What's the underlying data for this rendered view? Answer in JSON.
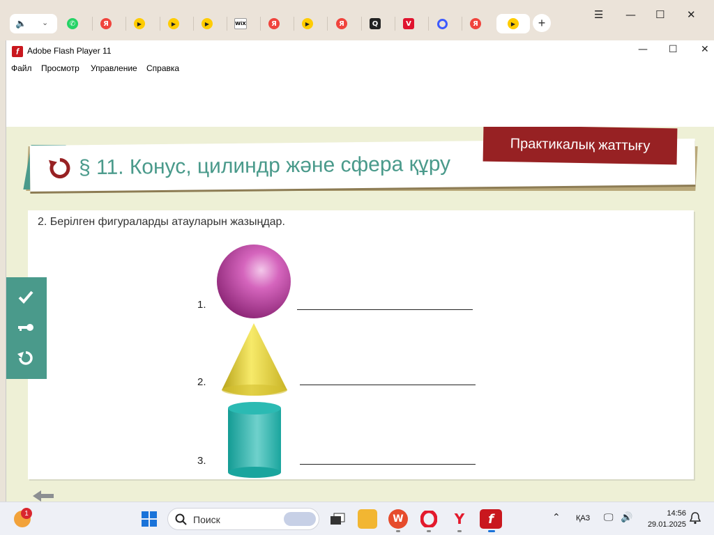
{
  "browser": {
    "window_controls": {
      "menu": "☰",
      "minimize": "—",
      "maximize": "☐",
      "close": "✕"
    },
    "tabs": [
      {
        "icon": "speaker-icon",
        "letter": "🔈"
      },
      {
        "icon": "whatsapp-icon",
        "letter": "✆"
      },
      {
        "icon": "yandex-icon",
        "letter": "Я"
      },
      {
        "icon": "play-icon",
        "letter": "▶"
      },
      {
        "icon": "play-icon",
        "letter": "▶"
      },
      {
        "icon": "play-icon",
        "letter": "▶"
      },
      {
        "icon": "wix-icon",
        "letter": "WiX"
      },
      {
        "icon": "yandex-icon",
        "letter": "Я"
      },
      {
        "icon": "play-icon",
        "letter": "▶"
      },
      {
        "icon": "yandex-icon",
        "letter": "Я"
      },
      {
        "icon": "q-icon",
        "letter": "Q"
      },
      {
        "icon": "v-icon",
        "letter": "V"
      },
      {
        "icon": "ring-icon",
        "letter": ""
      },
      {
        "icon": "yandex-icon",
        "letter": "Я"
      },
      {
        "icon": "play-icon",
        "letter": "▶"
      }
    ],
    "new_tab": "+"
  },
  "flash_window": {
    "title": "Adobe Flash Player 11",
    "logo_letter": "f",
    "controls": {
      "minimize": "—",
      "maximize": "☐",
      "close": "✕"
    },
    "menu": {
      "file": "Файл",
      "view": "Просмотр",
      "control": "Управление",
      "help": "Справка"
    }
  },
  "lesson": {
    "badge": "Практикалық жаттығу",
    "heading": "§ 11. Конус, цилиндр және сфера құру",
    "task": "2. Берілген фигураларды  атауларын жазыңдар.",
    "items": [
      {
        "number": "1.",
        "shape": "sphere",
        "answer": ""
      },
      {
        "number": "2.",
        "shape": "cone",
        "answer": ""
      },
      {
        "number": "3.",
        "shape": "cylinder",
        "answer": ""
      }
    ],
    "colors": {
      "teal": "#4a9a8b",
      "badge": "#972123",
      "sphere": "#c04ea8",
      "cone": "#e8d230",
      "cylinder": "#22b3ad"
    }
  },
  "taskbar": {
    "search_placeholder": "Поиск",
    "notification_count": "1",
    "language": "ҚАЗ",
    "time": "14:56",
    "date": "29.01.2025"
  }
}
